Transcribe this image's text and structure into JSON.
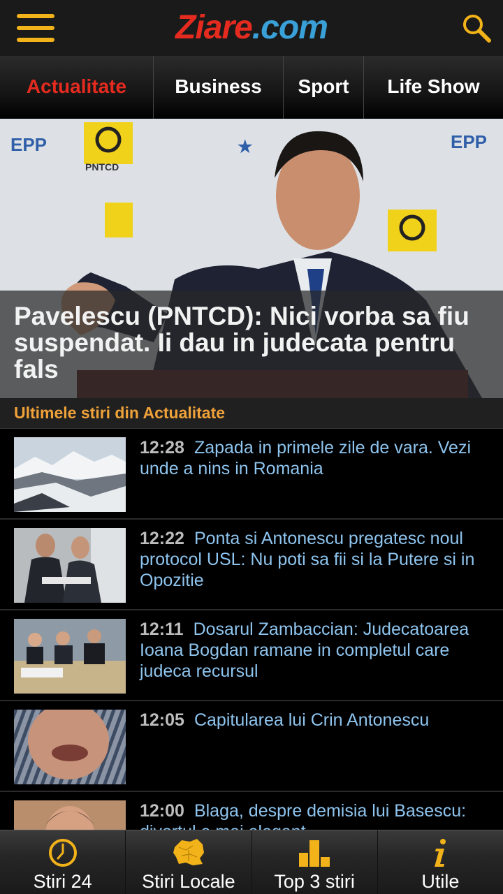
{
  "header": {
    "logo_part1": "Ziare",
    "logo_part2": ".com"
  },
  "tabs": [
    {
      "label": "Actualitate",
      "active": true
    },
    {
      "label": "Business",
      "active": false
    },
    {
      "label": "Sport",
      "active": false
    },
    {
      "label": "Life Show",
      "active": false
    }
  ],
  "hero": {
    "title": "Pavelescu (PNTCD): Nici vorba sa fiu suspendat. Ii dau in judecata pentru fals",
    "backdrop_texts": [
      "EPP",
      "PNTCD"
    ]
  },
  "section": {
    "title": "Ultimele stiri din Actualitate"
  },
  "news": [
    {
      "time": "12:28",
      "title": "Zapada in primele zile de vara. Vezi unde a nins in Romania"
    },
    {
      "time": "12:22",
      "title": "Ponta si Antonescu pregatesc noul protocol USL: Nu poti sa fii si la Putere si in Opozitie"
    },
    {
      "time": "12:11",
      "title": "Dosarul Zambaccian: Judecatoarea Ioana Bogdan ramane in completul care judeca recursul"
    },
    {
      "time": "12:05",
      "title": "Capitularea lui Crin Antonescu"
    },
    {
      "time": "12:00",
      "title": "Blaga, despre demisia lui Basescu: divortul e mai elegant"
    }
  ],
  "bottom_nav": [
    {
      "label": "Stiri 24",
      "icon": "clock-icon"
    },
    {
      "label": "Stiri Locale",
      "icon": "romania-map-icon"
    },
    {
      "label": "Top 3 stiri",
      "icon": "podium-icon"
    },
    {
      "label": "Utile",
      "icon": "info-icon"
    }
  ],
  "colors": {
    "accent": "#f2b21a",
    "active_tab": "#e52b1f",
    "link": "#8ec4ee",
    "section_title": "#f0a23a"
  }
}
